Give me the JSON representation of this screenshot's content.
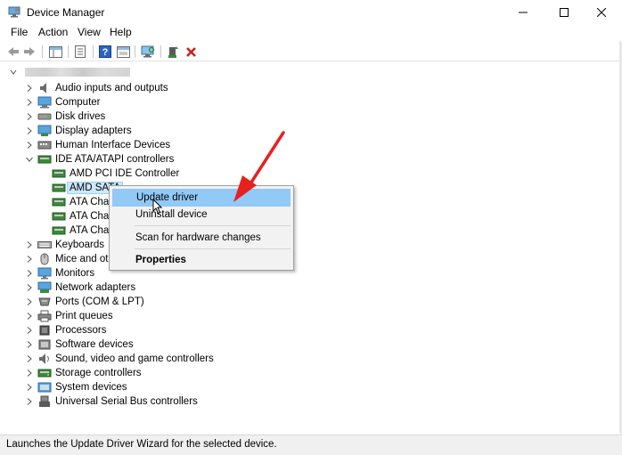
{
  "window": {
    "title": "Device Manager"
  },
  "menu": [
    "File",
    "Action",
    "View",
    "Help"
  ],
  "toolbar": [
    "back-icon",
    "forward-icon",
    "properties-pane-icon",
    "show-hide-tree-icon",
    "help-icon",
    "show-devices-icon",
    "scan-hardware-icon",
    "update-driver-icon",
    "uninstall-icon"
  ],
  "tree": {
    "categories": [
      {
        "label": "Audio inputs and outputs",
        "icon": "speaker-icon",
        "expanded": false
      },
      {
        "label": "Computer",
        "icon": "computer-icon",
        "expanded": false
      },
      {
        "label": "Disk drives",
        "icon": "disk-drive-icon",
        "expanded": false
      },
      {
        "label": "Display adapters",
        "icon": "display-adapter-icon",
        "expanded": false
      },
      {
        "label": "Human Interface Devices",
        "icon": "hid-icon",
        "expanded": false
      },
      {
        "label": "IDE ATA/ATAPI controllers",
        "icon": "ide-controller-icon",
        "expanded": true
      },
      {
        "label": "Keyboards",
        "icon": "keyboard-icon",
        "expanded": false
      },
      {
        "label": "Mice and oth",
        "icon": "mouse-icon",
        "expanded": false
      },
      {
        "label": "Monitors",
        "icon": "monitor-icon",
        "expanded": false
      },
      {
        "label": "Network adapters",
        "icon": "network-adapter-icon",
        "expanded": false
      },
      {
        "label": "Ports (COM & LPT)",
        "icon": "port-icon",
        "expanded": false
      },
      {
        "label": "Print queues",
        "icon": "printer-icon",
        "expanded": false
      },
      {
        "label": "Processors",
        "icon": "processor-icon",
        "expanded": false
      },
      {
        "label": "Software devices",
        "icon": "software-device-icon",
        "expanded": false
      },
      {
        "label": "Sound, video and game controllers",
        "icon": "sound-controller-icon",
        "expanded": false
      },
      {
        "label": "Storage controllers",
        "icon": "storage-controller-icon",
        "expanded": false
      },
      {
        "label": "System devices",
        "icon": "system-device-icon",
        "expanded": false
      },
      {
        "label": "Universal Serial Bus controllers",
        "icon": "usb-icon",
        "expanded": false
      }
    ],
    "ide_children": [
      {
        "label": "AMD PCI IDE Controller",
        "selected": false
      },
      {
        "label": "AMD SATA",
        "selected": true
      },
      {
        "label": "ATA Chan",
        "selected": false
      },
      {
        "label": "ATA Chan",
        "selected": false
      },
      {
        "label": "ATA Chan",
        "selected": false
      }
    ]
  },
  "context_menu": {
    "items": [
      {
        "label": "Update driver",
        "highlighted": true,
        "bold": false
      },
      {
        "label": "Uninstall device",
        "highlighted": false,
        "bold": false
      },
      {
        "label": "Scan for hardware changes",
        "highlighted": false,
        "bold": false
      },
      {
        "label": "Properties",
        "highlighted": false,
        "bold": true
      }
    ]
  },
  "status": {
    "text": "Launches the Update Driver Wizard for the selected device."
  },
  "colors": {
    "selection": "#cde8ff",
    "menu_highlight": "#91c9f7",
    "arrow": "#e8201f",
    "uninstall_x": "#d01d1d"
  }
}
